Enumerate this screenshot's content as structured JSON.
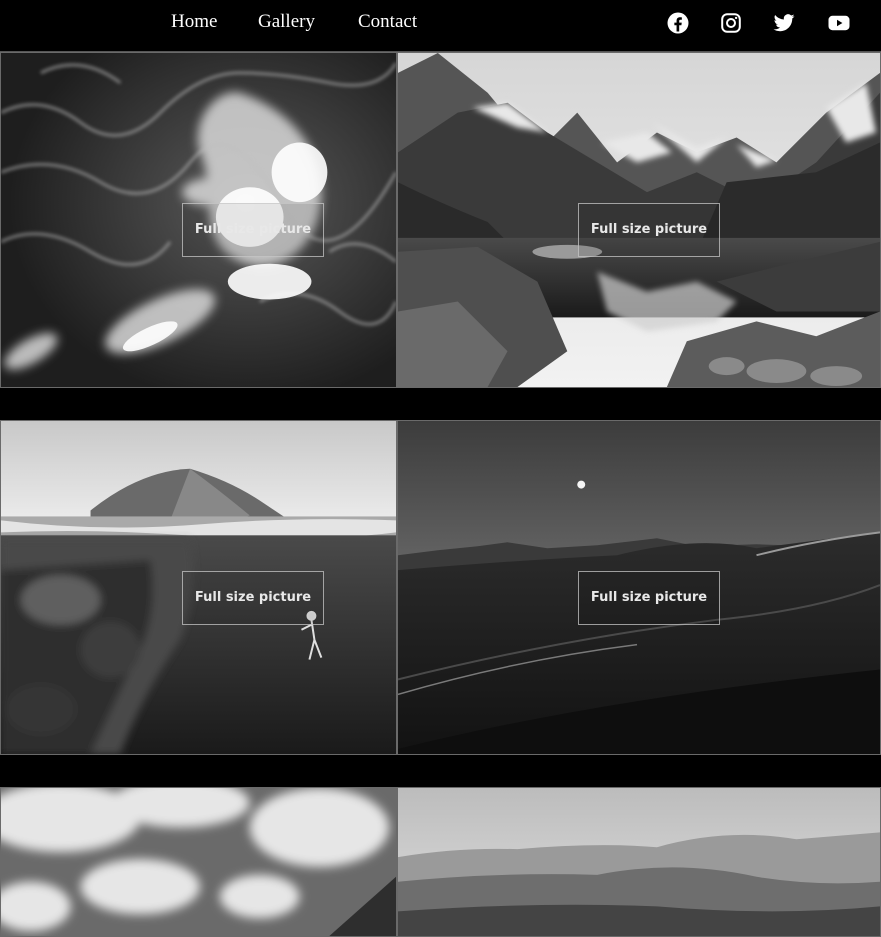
{
  "nav": {
    "links": [
      {
        "label": "Home"
      },
      {
        "label": "Gallery"
      },
      {
        "label": "Contact"
      }
    ],
    "social": [
      {
        "icon": "facebook-icon"
      },
      {
        "icon": "instagram-icon"
      },
      {
        "icon": "twitter-icon"
      },
      {
        "icon": "youtube-icon"
      }
    ]
  },
  "gallery": {
    "button_label": "Full size picture",
    "tiles": [
      {
        "subject": "ocean waves aerial"
      },
      {
        "subject": "mountain lake"
      },
      {
        "subject": "underwater diver"
      },
      {
        "subject": "desert dunes moon"
      },
      {
        "subject": "clouds sky"
      },
      {
        "subject": "hazy hills"
      }
    ]
  }
}
